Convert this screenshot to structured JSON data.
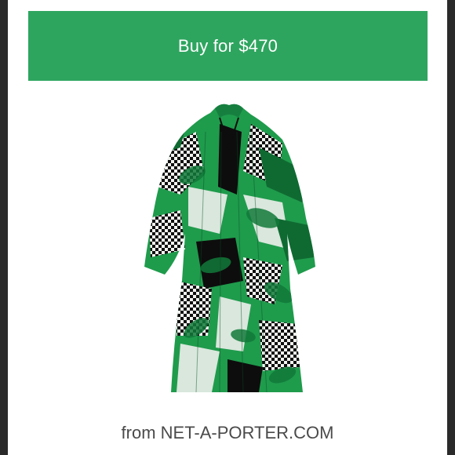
{
  "buy_button": {
    "label": "Buy for $470"
  },
  "product": {
    "image_description": "green dress",
    "colors": {
      "primary": "#1f9b4c",
      "secondary": "#0f6a31",
      "light": "#d9e7dc",
      "dark": "#111111"
    }
  },
  "source": {
    "prefix": "from",
    "store": "NET-A-PORTER.COM"
  },
  "theme": {
    "button_color": "#2ea55f",
    "background": "#ffffff",
    "frame": "#2a2a2a",
    "text_muted": "#4a4a4a"
  }
}
